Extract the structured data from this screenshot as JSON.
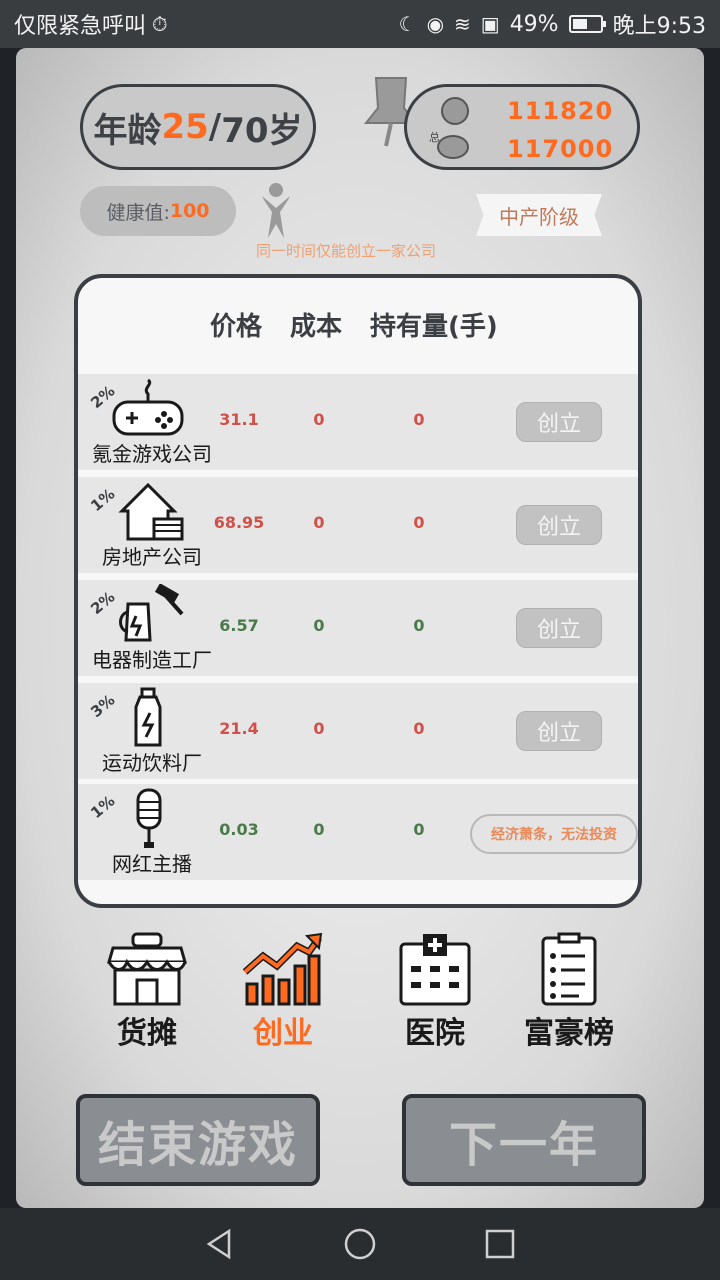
{
  "statusbar": {
    "left_text": "仅限紧急呼叫",
    "battery": "49%",
    "time": "晚上9:53"
  },
  "top": {
    "age_label": "年龄",
    "age_current": "25",
    "age_sep": "/",
    "age_max": "70岁",
    "money_cash": "111820",
    "money_total": "117000",
    "money_total_label": "总",
    "health_label": "健康值:",
    "health_value": "100",
    "class_tag": "中产阶级",
    "notice": "同一时间仅能创立一家公司"
  },
  "table": {
    "headers": [
      "价格",
      "成本",
      "持有量(手)"
    ],
    "rows": [
      {
        "pct": "2%",
        "icon": "gamepad-icon",
        "name": "氪金游戏公司",
        "price": "31.1",
        "cost": "0",
        "hold": "0",
        "price_color": "red",
        "action": "创立",
        "disabled": false
      },
      {
        "pct": "1%",
        "icon": "house-icon",
        "name": "房地产公司",
        "price": "68.95",
        "cost": "0",
        "hold": "0",
        "price_color": "red",
        "action": "创立",
        "disabled": false
      },
      {
        "pct": "2%",
        "icon": "kettle-hammer-icon",
        "name": "电器制造工厂",
        "price": "6.57",
        "cost": "0",
        "hold": "0",
        "price_color": "green",
        "action": "创立",
        "disabled": false
      },
      {
        "pct": "3%",
        "icon": "bottle-icon",
        "name": "运动饮料厂",
        "price": "21.4",
        "cost": "0",
        "hold": "0",
        "price_color": "red",
        "action": "创立",
        "disabled": false
      },
      {
        "pct": "1%",
        "icon": "microphone-icon",
        "name": "网红主播",
        "price": "0.03",
        "cost": "0",
        "hold": "0",
        "price_color": "green",
        "action": "经济萧条，无法投资",
        "disabled": true
      }
    ]
  },
  "nav": {
    "items": [
      {
        "label": "货摊",
        "icon": "stall-icon",
        "active": false
      },
      {
        "label": "创业",
        "icon": "growth-chart-icon",
        "active": true
      },
      {
        "label": "医院",
        "icon": "hospital-icon",
        "active": false
      },
      {
        "label": "富豪榜",
        "icon": "list-icon",
        "active": false
      }
    ]
  },
  "buttons": {
    "end_game": "结束游戏",
    "next_year": "下一年"
  },
  "colors": {
    "accent": "#ff6a21",
    "dark": "#3b3e42",
    "price_red": "#d0504a",
    "price_green": "#4a7a4a"
  }
}
